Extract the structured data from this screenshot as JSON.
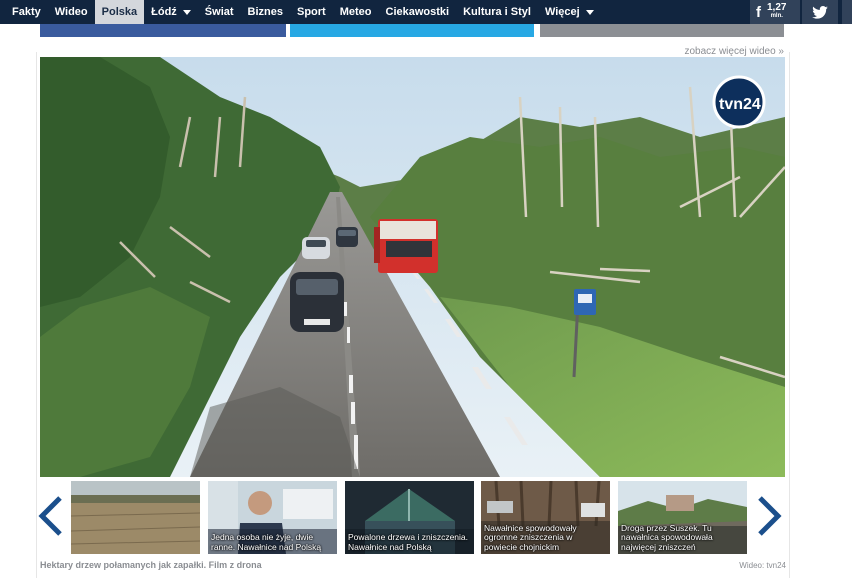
{
  "nav": {
    "items": [
      {
        "label": "Fakty"
      },
      {
        "label": "Wideo"
      },
      {
        "label": "Polska",
        "active": true
      },
      {
        "label": "Łódź",
        "dropdown": true
      },
      {
        "label": "Świat"
      },
      {
        "label": "Biznes"
      },
      {
        "label": "Sport"
      },
      {
        "label": "Meteo"
      },
      {
        "label": "Ciekawostki"
      },
      {
        "label": "Kultura i Styl"
      },
      {
        "label": "Więcej",
        "dropdown": true
      }
    ],
    "facebook": {
      "count": "1,27",
      "unit": "mln."
    }
  },
  "colors": {
    "nav_bg": "#11253f",
    "nav_active_bg": "#d4d7dc",
    "facebook": "#3a5b9e",
    "twitter": "#27a8e4",
    "mail": "#8c8f94",
    "accent": "#1b4f8c"
  },
  "share": {
    "icons": [
      "facebook-icon",
      "twitter-icon",
      "mail-icon"
    ]
  },
  "more_video": "zobacz więcej wideo »",
  "video": {
    "logo": "tvn24"
  },
  "thumbnails": [
    {
      "caption": "",
      "active": true
    },
    {
      "caption": "Jedna osoba nie żyje, dwie ranne. Nawałnice nad Polską"
    },
    {
      "caption": "Powalone drzewa i zniszczenia. Nawałnice nad Polską"
    },
    {
      "caption": "Nawałnice spowodowały ogromne zniszczenia w powiecie chojnickim"
    },
    {
      "caption": "Droga przez Suszek. Tu nawałnica spowodowała najwięcej zniszczeń"
    }
  ],
  "caption": "Hektary drzew połamanych jak zapałki. Film z drona",
  "credit": "Wideo: tvn24"
}
